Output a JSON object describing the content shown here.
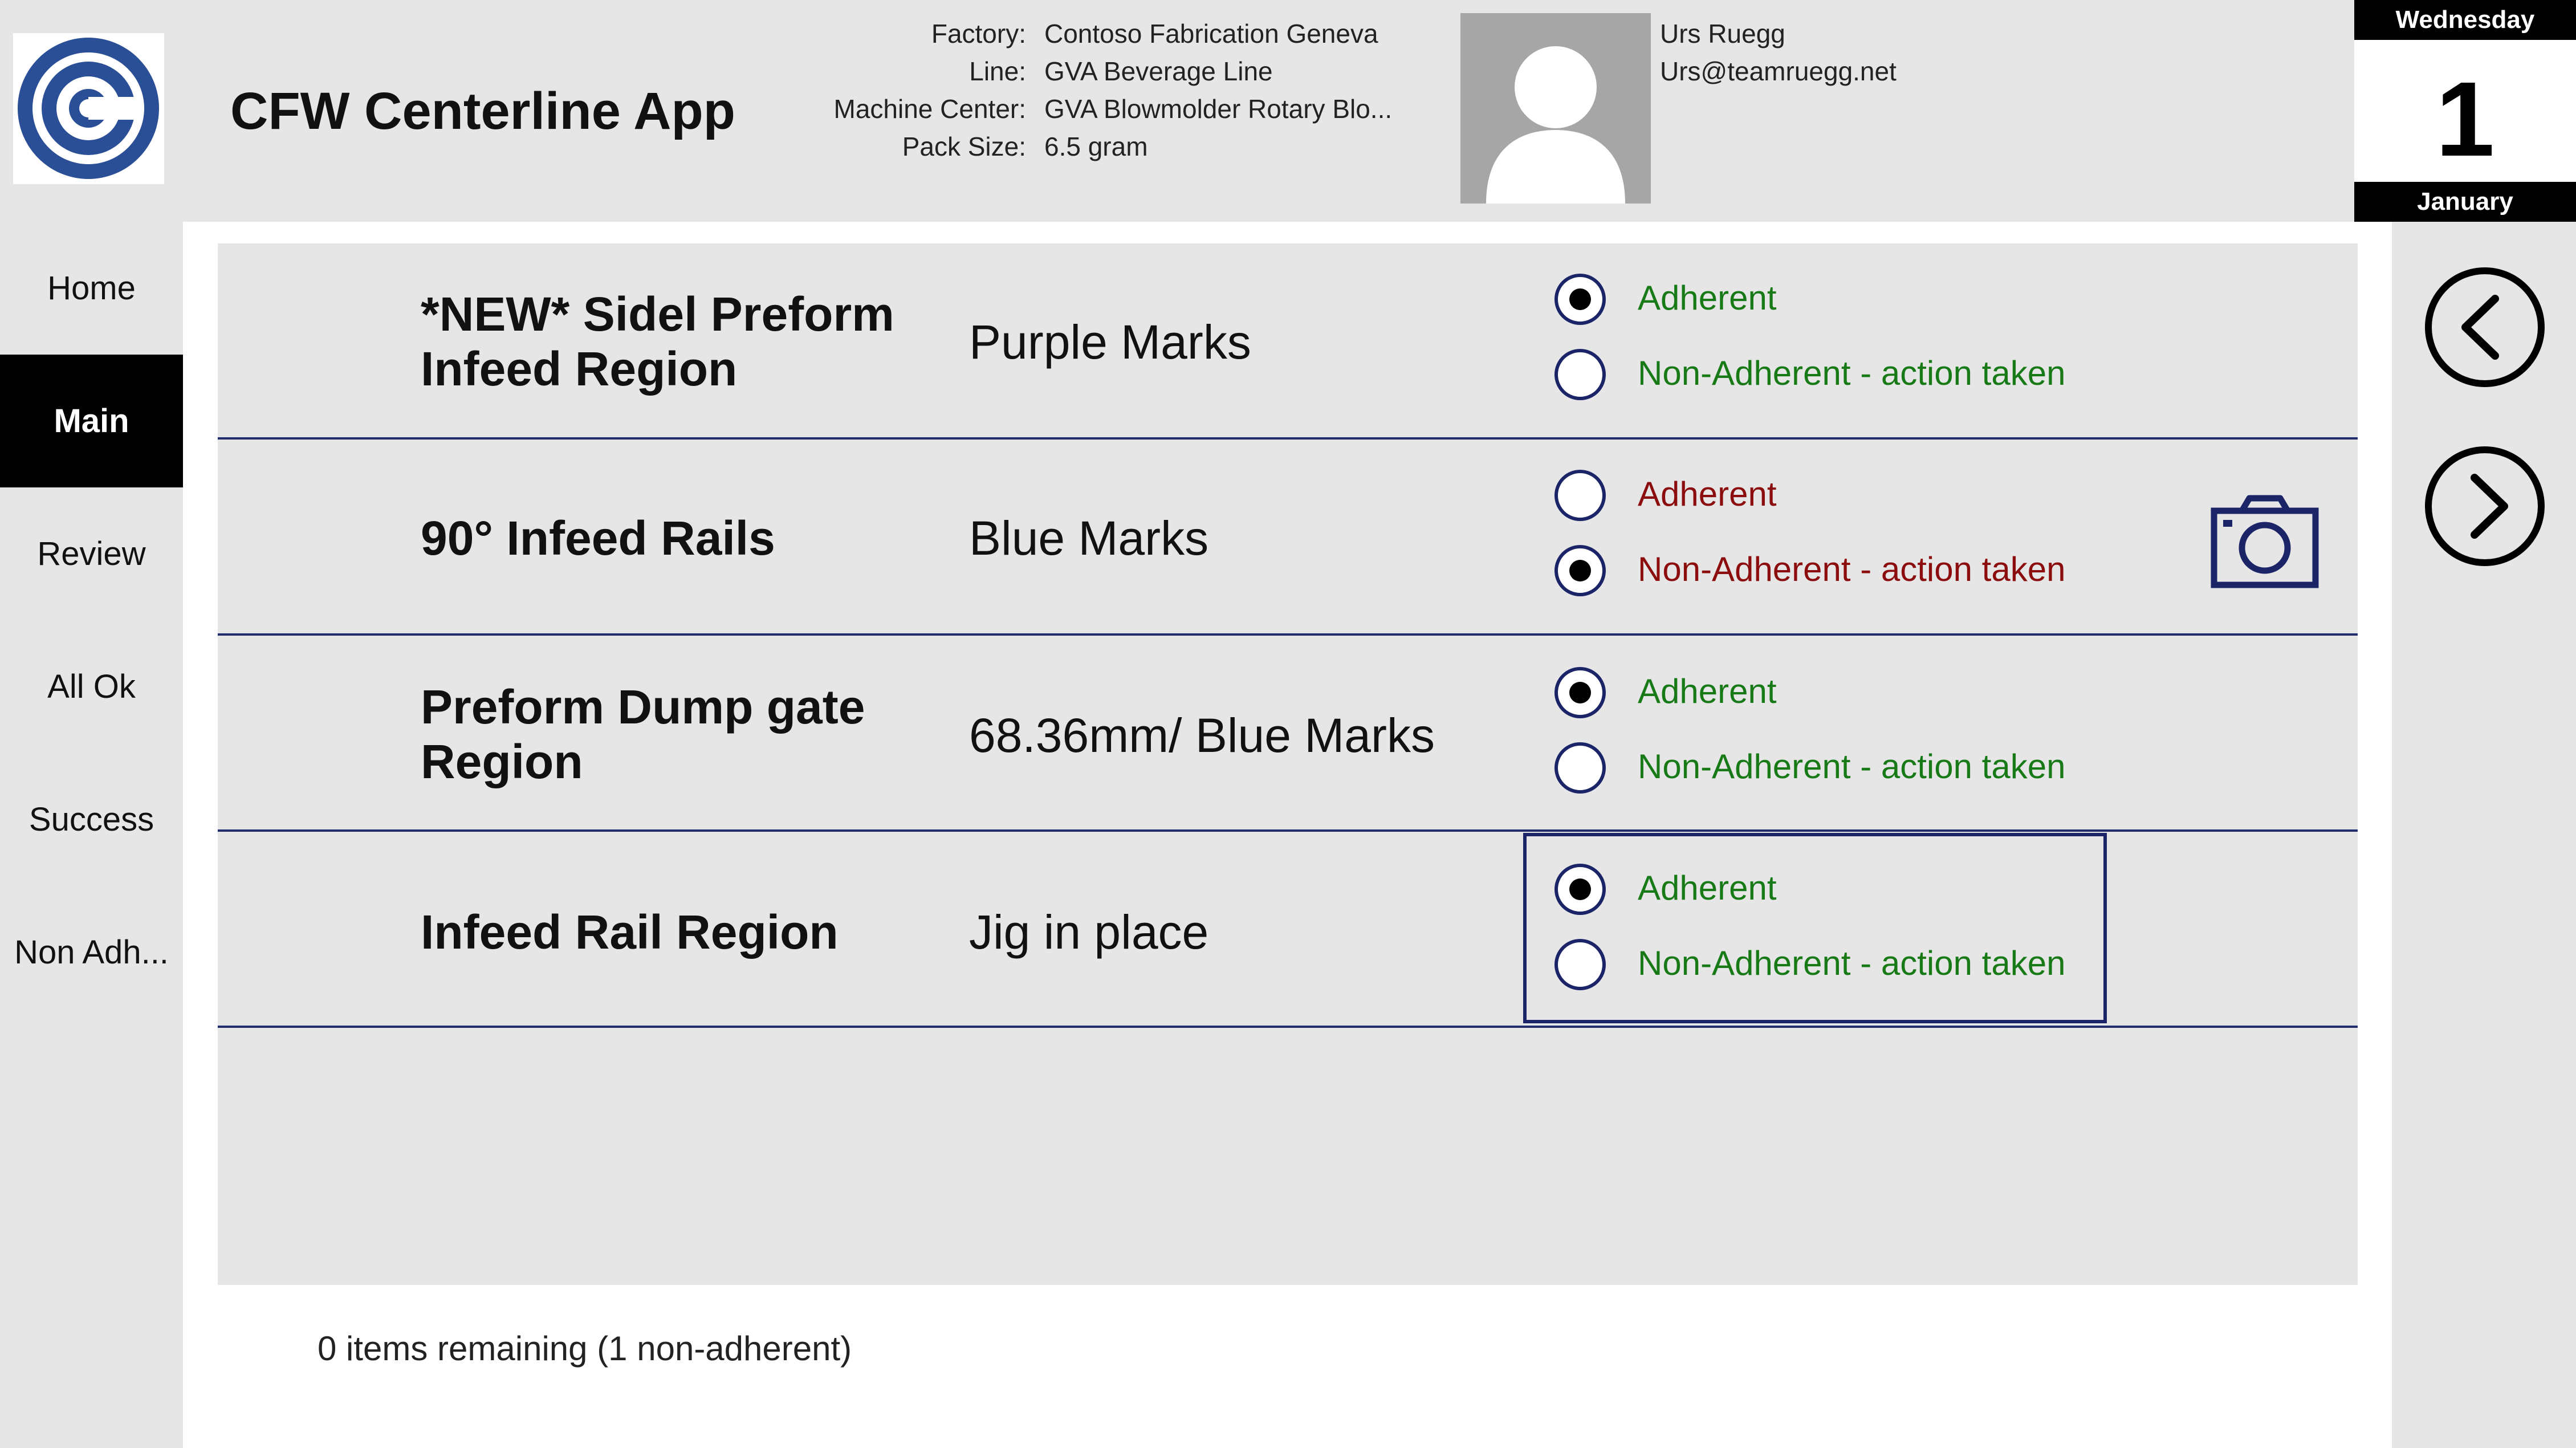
{
  "app": {
    "title": "CFW Centerline App"
  },
  "header": {
    "info": [
      {
        "label": "Factory:",
        "value": "Contoso Fabrication Geneva"
      },
      {
        "label": "Line:",
        "value": "GVA Beverage Line"
      },
      {
        "label": "Machine Center:",
        "value": "GVA Blowmolder Rotary Blo..."
      },
      {
        "label": "Pack Size:",
        "value": "6.5 gram"
      }
    ],
    "user": {
      "name": "Urs Ruegg",
      "email": "Urs@teamruegg.net"
    }
  },
  "date": {
    "weekday": "Wednesday",
    "day": "1",
    "month": "January"
  },
  "nav": {
    "items": [
      {
        "label": "Home",
        "active": false
      },
      {
        "label": "Main",
        "active": true
      },
      {
        "label": "Review",
        "active": false
      },
      {
        "label": "All Ok",
        "active": false
      },
      {
        "label": "Success",
        "active": false
      },
      {
        "label": "Non Adh...",
        "active": false
      }
    ]
  },
  "checklist": {
    "option_adherent": "Adherent",
    "option_non_adherent": "Non-Adherent - action taken",
    "rows": [
      {
        "title_line1": "*NEW* Sidel Preform",
        "title_line2": "Infeed Region",
        "value": "Purple Marks",
        "selected": "Adherent"
      },
      {
        "title_line1": "90° Infeed Rails",
        "title_line2": "",
        "value": "Blue Marks",
        "selected": "Non-Adherent - action taken"
      },
      {
        "title_line1": "Preform Dump gate",
        "title_line2": "Region",
        "value": "68.36mm/ Blue Marks",
        "selected": "Adherent"
      },
      {
        "title_line1": "Infeed Rail Region",
        "title_line2": "",
        "value": "Jig in place",
        "selected": "Adherent"
      }
    ]
  },
  "footer": {
    "status": "0 items remaining (1 non-adherent)"
  },
  "icons": {
    "logo": "company-logo-icon",
    "avatar": "user-avatar-icon",
    "prev": "chevron-left-circle-icon",
    "next": "chevron-right-circle-icon",
    "camera": "camera-icon"
  },
  "colors": {
    "panel": "#e6e6e6",
    "accent": "#1a2466",
    "adherent_text": "#177a17",
    "non_adherent_text": "#8b0d0d",
    "logo_blue": "#2a4f96"
  }
}
